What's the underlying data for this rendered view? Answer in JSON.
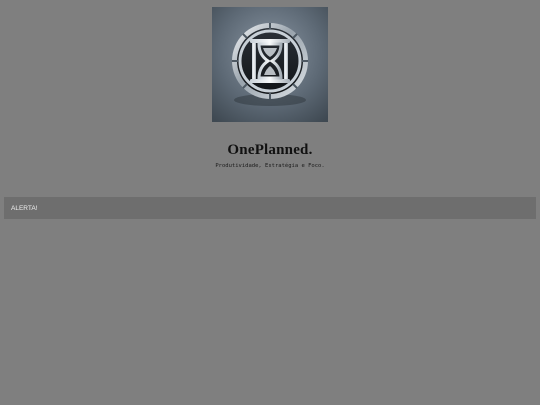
{
  "brand": {
    "logo_icon": "hourglass-logo-icon",
    "title": "OnePlanned.",
    "subtitle": "Produtividade, Estratégia e Foco."
  },
  "alert": {
    "label": "ALERTA!"
  },
  "colors": {
    "page_background": "#7f7f7f",
    "alert_background": "#6e6e6e",
    "alert_text": "#f2f2f2"
  }
}
